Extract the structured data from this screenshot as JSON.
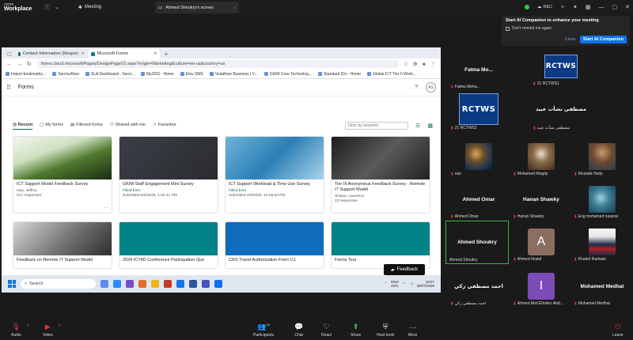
{
  "zoom": {
    "logo_top": "zoom",
    "logo_bottom": "Workplace",
    "meeting_label": "Meeting",
    "screen_tab": "Ahmed Shoukry's screen",
    "rec_label": "REC"
  },
  "ai_companion": {
    "title": "Start AI Companion to enhance your meeting",
    "checkbox": "Don't remind me again",
    "close": "Close",
    "start": "Start AI Companion"
  },
  "browser": {
    "tabs": [
      {
        "label": "Contact Information (Respon",
        "color": "#107c41"
      },
      {
        "label": "Microsoft Forms",
        "color": "#038387"
      }
    ],
    "new_tab": "+",
    "url": "forms.cloud.microsoft/Pages/DesignPageV2.aspx?origin=Marketing&culture=en-us&country=us",
    "bookmarks": [
      "Import bookmarks...",
      "ServiceNow",
      "SLA Dashboard - Servi...",
      "MyCRS - Home",
      "Elev SMS",
      "Vodafone Business | V...",
      "GKIM Core Technolog...",
      "Standard IDs - Home",
      "Global ICT Tier II Work..."
    ]
  },
  "forms": {
    "title": "Forms",
    "help": "?",
    "avatar": "AS",
    "filters": [
      "Recent",
      "My forms",
      "Filtered forms",
      "Shared with me",
      "Favorites"
    ],
    "search_placeholder": "Filter by keyword",
    "cards": [
      {
        "title": "ICT Support Model Feedback Survey",
        "line1": "Issa, Jeffrey",
        "line2": "517 responses",
        "img": "linear-gradient(160deg,#f2f6ee 0%,#cfe0c0 35%,#4f7a2f 60%,#1b2b12 100%)"
      },
      {
        "title": "GKIM Staff Engagement Mini Survey",
        "line1": "Filled form",
        "line2": "Submitted 5/5/2026, 1:04:41 PM",
        "img": "linear-gradient(135deg,#3b3e45 0%,#2a2c31 100%)"
      },
      {
        "title": "ICT Support Workload & Time Use Survey",
        "line1": "Filled form",
        "line2": "Submitted 4/9/2026, 12:55:53 PM",
        "img": "linear-gradient(135deg,#6fb3d9 0%,#2a7fb6 50%,#aad4ee 100%)"
      },
      {
        "title": "Tier III Anonymous Feedback Survey - Remote IT Support Model",
        "line1": "Shawa, Laurence",
        "line2": "13 responses",
        "img": "linear-gradient(135deg,#1c1c1c 0%,#5a5a5a 50%,#222 100%)"
      }
    ],
    "cards_row2": [
      {
        "title": "Feedback on Remote IT Support Model",
        "img": "linear-gradient(135deg,#d9d9d9 0%,#7a7a7a 50%,#2d2d2d 100%)"
      },
      {
        "title": "2024 ICT4D Conference Participation Que",
        "img": "#038387"
      },
      {
        "title": "CRS Travel Authorization Form V.1",
        "img": "#0f6cbd"
      },
      {
        "title": "Forms Test",
        "img": "#038387"
      }
    ],
    "feedback": "Feedback"
  },
  "taskbar": {
    "search": "Search",
    "lang1": "ENG",
    "lang2": "INTL",
    "time": "19:57",
    "date": "28/07/2026"
  },
  "participants": [
    {
      "label": "Fatma Moha...",
      "big": "Fatma Mo...",
      "type": "text"
    },
    {
      "label": "21 RCTWS1",
      "big": "RCTWS",
      "type": "logo"
    },
    {
      "label": "21 RCTWS1",
      "big": "RCTWS",
      "type": "logo"
    },
    {
      "label": "مصطفى نشأت عبيد",
      "big": "مصطفى نشأت عبيد",
      "type": "text"
    },
    {
      "label": "nas",
      "type": "photo"
    },
    {
      "label": "Mohamed Magdy",
      "type": "photo"
    },
    {
      "label": "Mostafa Hady",
      "type": "photo"
    },
    {
      "label": "Ahmed Omar",
      "big": "Ahmed Omar",
      "type": "text"
    },
    {
      "label": "Hanan Shawky",
      "big": "Hanan Shawky",
      "type": "text"
    },
    {
      "label": "Eng mohamed nassrat",
      "type": "photo"
    },
    {
      "label": "Ahmed Shoukry",
      "big": "Ahmed Shoukry",
      "type": "text"
    },
    {
      "label": "Ahmed khalaf",
      "big": "A",
      "type": "letter"
    },
    {
      "label": "Khaled Radwan",
      "type": "photo"
    },
    {
      "label": "احمد مصطفي زكي",
      "big": "احمد مصطفي زكي",
      "type": "text"
    },
    {
      "label": "Ahmed Abd Elhafez Abd...",
      "big": "I",
      "type": "letter"
    },
    {
      "label": "Mohamed Medhat",
      "big": "Mohamed Medhat",
      "type": "text"
    }
  ],
  "toolbar": {
    "audio": "Audio",
    "video": "Video",
    "participants": "Participants",
    "participants_count": "16",
    "chat": "Chat",
    "react": "React",
    "share": "Share",
    "host_tools": "Host tools",
    "more": "More",
    "leave": "Leave"
  },
  "colors": {
    "forms_accent": "#0f6e5a",
    "zoom_blue": "#0e72ed",
    "leave_red": "#e03535"
  }
}
